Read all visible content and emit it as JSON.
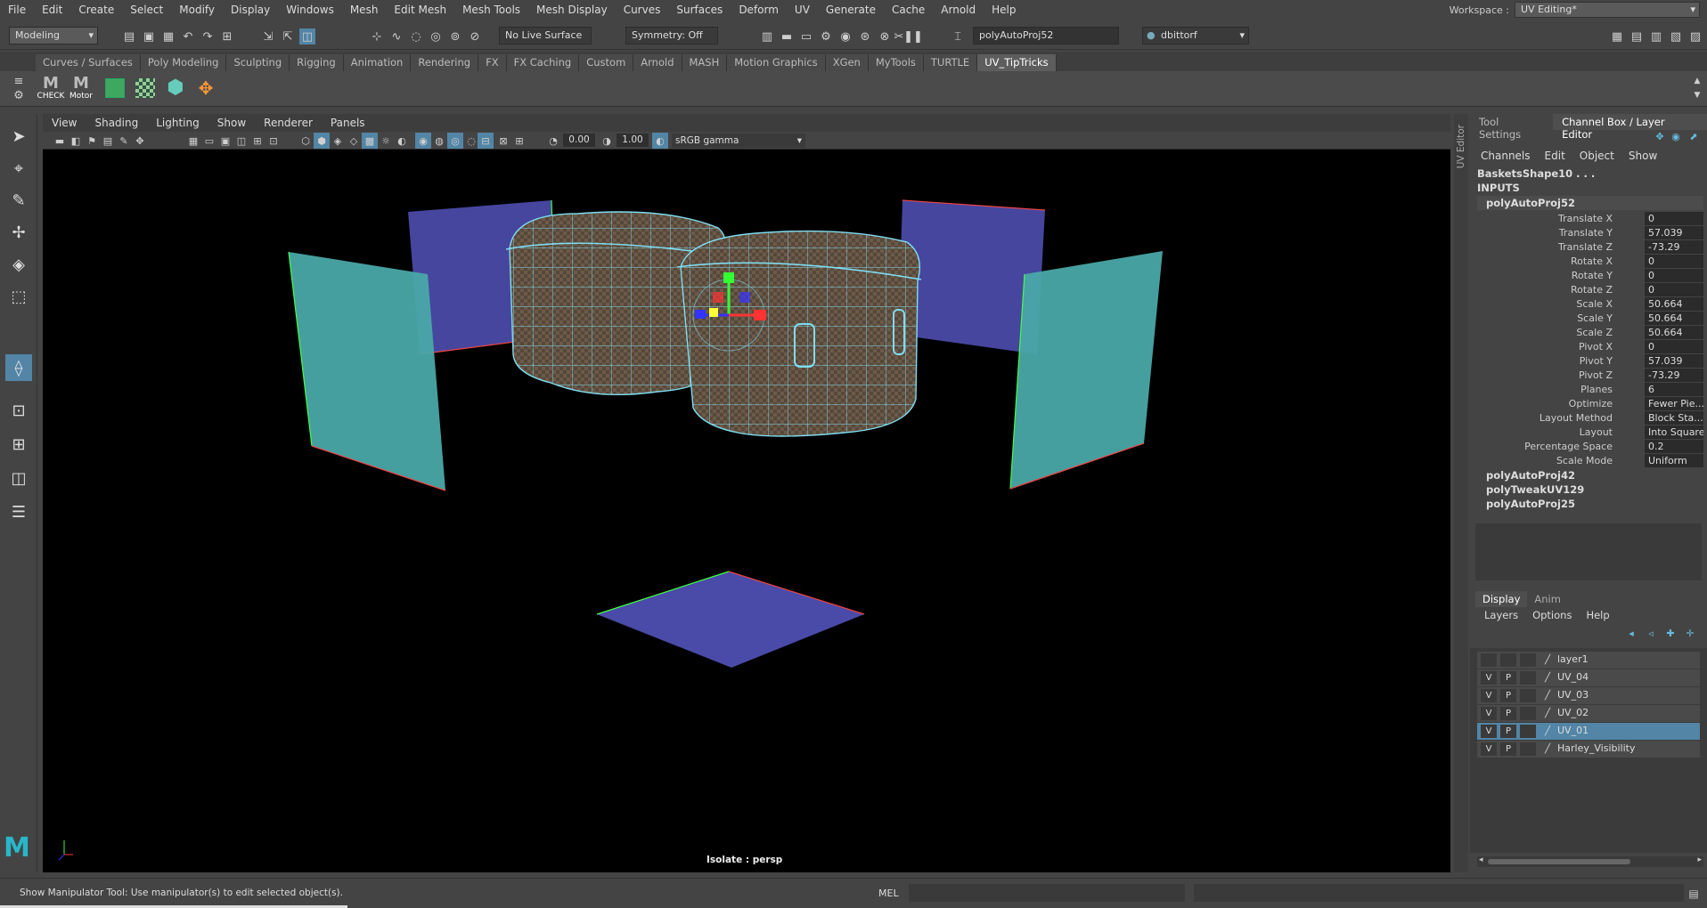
{
  "menubar": {
    "items": [
      "File",
      "Edit",
      "Create",
      "Select",
      "Modify",
      "Display",
      "Windows",
      "Mesh",
      "Edit Mesh",
      "Mesh Tools",
      "Mesh Display",
      "Curves",
      "Surfaces",
      "Deform",
      "UV",
      "Generate",
      "Cache",
      "Arnold",
      "Help"
    ],
    "workspace_label": "Workspace :",
    "workspace_value": "UV Editing*"
  },
  "statusline": {
    "mode": "Modeling",
    "live_surface": "No Live Surface",
    "symmetry": "Symmetry: Off",
    "name_field": "polyAutoProj52",
    "user": "dbittorf"
  },
  "shelf": {
    "tabs": [
      "Curves / Surfaces",
      "Poly Modeling",
      "Sculpting",
      "Rigging",
      "Animation",
      "Rendering",
      "FX",
      "FX Caching",
      "Custom",
      "Arnold",
      "MASH",
      "Motion Graphics",
      "XGen",
      "MyTools",
      "TURTLE",
      "UV_TipTricks"
    ],
    "active_tab": 15,
    "buttons": [
      {
        "label": "CHECK"
      },
      {
        "label": "Motor"
      }
    ]
  },
  "viewport": {
    "menu": [
      "View",
      "Shading",
      "Lighting",
      "Show",
      "Renderer",
      "Panels"
    ],
    "exposure": "0.00",
    "gamma": "1.00",
    "color_space": "sRGB gamma",
    "hud_label": "Isolate : persp"
  },
  "uv_editor_tab": "UV Editor",
  "channel_box": {
    "tabs": [
      "Tool Settings",
      "Channel Box / Layer Editor"
    ],
    "menu": [
      "Channels",
      "Edit",
      "Object",
      "Show"
    ],
    "shape": "BasketsShape10 . . .",
    "inputs_label": "INPUTS",
    "node": "polyAutoProj52",
    "attributes": [
      {
        "name": "Translate X",
        "value": "0"
      },
      {
        "name": "Translate Y",
        "value": "57.039"
      },
      {
        "name": "Translate Z",
        "value": "-73.29"
      },
      {
        "name": "Rotate X",
        "value": "0"
      },
      {
        "name": "Rotate Y",
        "value": "0"
      },
      {
        "name": "Rotate Z",
        "value": "0"
      },
      {
        "name": "Scale X",
        "value": "50.664"
      },
      {
        "name": "Scale Y",
        "value": "50.664"
      },
      {
        "name": "Scale Z",
        "value": "50.664"
      },
      {
        "name": "Pivot X",
        "value": "0"
      },
      {
        "name": "Pivot Y",
        "value": "57.039"
      },
      {
        "name": "Pivot Z",
        "value": "-73.29"
      },
      {
        "name": "Planes",
        "value": "6"
      },
      {
        "name": "Optimize",
        "value": "Fewer Pie..."
      },
      {
        "name": "Layout Method",
        "value": "Block Sta..."
      },
      {
        "name": "Layout",
        "value": "Into Square"
      },
      {
        "name": "Percentage Space",
        "value": "0.2"
      },
      {
        "name": "Scale Mode",
        "value": "Uniform"
      }
    ],
    "other_nodes": [
      "polyAutoProj42",
      "polyTweakUV129",
      "polyAutoProj25"
    ]
  },
  "layer_editor": {
    "tabs": [
      "Display",
      "Anim"
    ],
    "menu": [
      "Layers",
      "Options",
      "Help"
    ],
    "layers": [
      {
        "v": "",
        "p": "",
        "name": "layer1",
        "selected": false
      },
      {
        "v": "V",
        "p": "P",
        "name": "UV_04",
        "selected": false
      },
      {
        "v": "V",
        "p": "P",
        "name": "UV_03",
        "selected": false
      },
      {
        "v": "V",
        "p": "P",
        "name": "UV_02",
        "selected": false
      },
      {
        "v": "V",
        "p": "P",
        "name": "UV_01",
        "selected": true
      },
      {
        "v": "V",
        "p": "P",
        "name": "Harley_Visibility",
        "selected": false
      }
    ]
  },
  "helpline": {
    "message": "Show Manipulator Tool: Use manipulator(s) to edit selected object(s).",
    "script_type": "MEL"
  },
  "colors": {
    "accent": "#5285a6",
    "wire": "#7fdcf0",
    "plane_blue": "#4a4aa8",
    "plane_teal": "#4aa8a8",
    "maya_logo": "#29b6c8"
  }
}
